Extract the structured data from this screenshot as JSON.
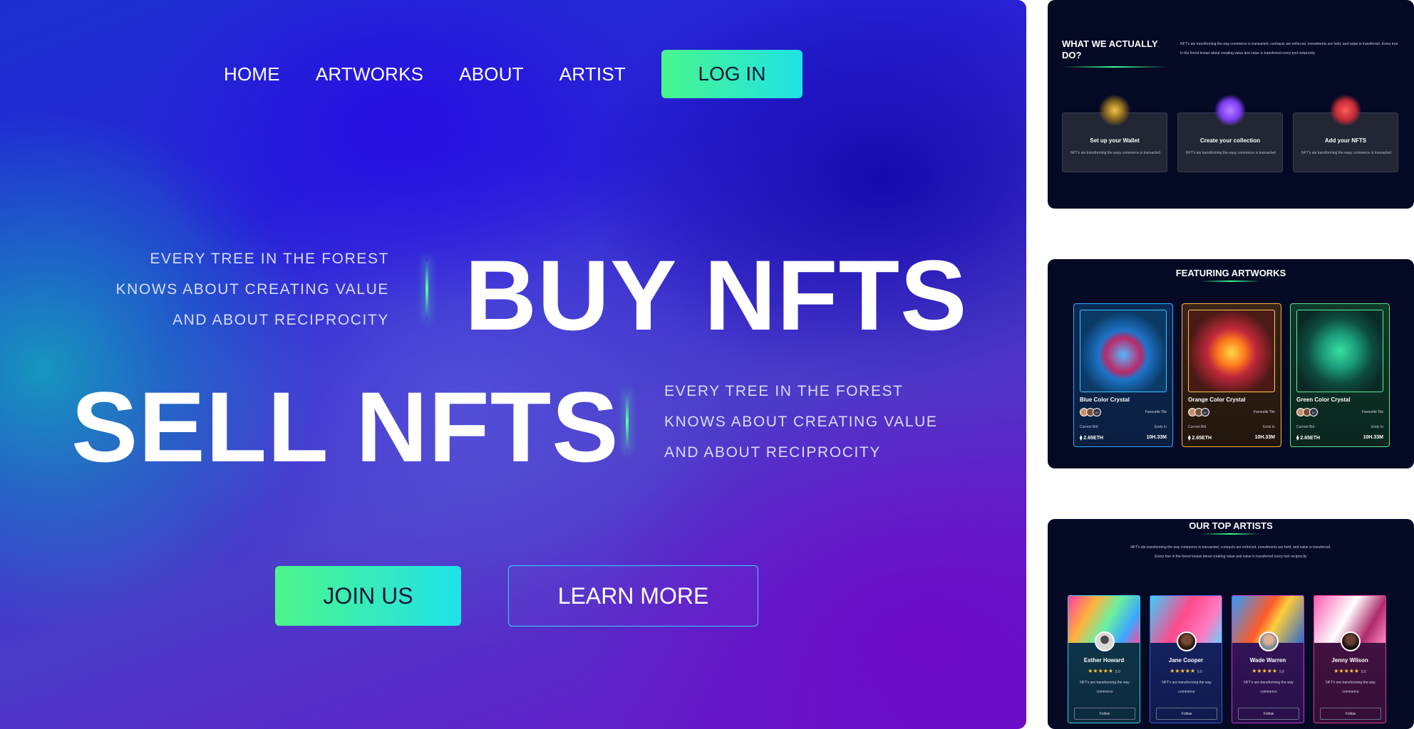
{
  "hero": {
    "nav": [
      "HOME",
      "ARTWORKS",
      "ABOUT",
      "ARTIST"
    ],
    "login_label": "LOG IN",
    "tagline_lines": [
      "EVERY TREE IN THE FOREST",
      "KNOWS ABOUT CREATING VALUE",
      "AND ABOUT RECIPROCITY"
    ],
    "buy_heading": "BUY NFTS",
    "sell_heading": "SELL NFTS",
    "join_label": "JOIN US",
    "learn_label": "LEARN MORE",
    "colors": {
      "gradient_button_start": "#4ef58a",
      "gradient_button_end": "#1fe2e8",
      "outline_button": "#3ad0ff"
    }
  },
  "what_we_do": {
    "title": "WHAT WE ACTUALLY DO?",
    "description": "NFT's ale transforming the way commerce is transacted, contracts are enforced, investments are held, and value is transferred. Every tree in the forest knows about creating value and value is transferred every tool reciprocity",
    "steps": [
      {
        "icon": "wallet-icon",
        "title": "Set up your Wallet",
        "desc": "NFT's ale transforming the wayy commerce is transacted"
      },
      {
        "icon": "camera-icon",
        "title": "Create your collection",
        "desc": "NFT's ale transforming the wayy commerce is transacted"
      },
      {
        "icon": "gift-icon",
        "title": "Add your NFTS",
        "desc": "NFT's ale transforming the wayy commerce is transacted"
      }
    ]
  },
  "featuring": {
    "title": "FEATURING ARTWORKS",
    "cards": [
      {
        "name": "Blue Color Crystal",
        "fav": "Favourite Tile",
        "badge": "2+",
        "bid_label": "Current Bid",
        "bid": "2.65ETH",
        "ends_label": "Ends In",
        "ends": "10H.33M"
      },
      {
        "name": "Orange Color Crystal",
        "fav": "Favourite Tile",
        "badge": "2+",
        "bid_label": "Current Bid",
        "bid": "2.65ETH",
        "ends_label": "Ends In",
        "ends": "10H.33M"
      },
      {
        "name": "Green Color Crystal",
        "fav": "Favourite Tile",
        "badge": "2+",
        "bid_label": "Current Bid",
        "bid": "2.65ETH",
        "ends_label": "Ends In",
        "ends": "10H.33M"
      }
    ],
    "eth_symbol": "⧫"
  },
  "top_artists": {
    "title": "OUR TOP ARTISTS",
    "description": "NFT's ale transforming the way commerce is transacted, contracts are enforced, investments are held, and value is transferred. Every tree in the forest knows about creating value and value is transferred every tool reciprocity",
    "artists": [
      {
        "name": "Esther Howard",
        "stars": "★★★★★",
        "rating": "5.0",
        "desc": "NFT's are transforming the way commerce",
        "follow": "Follow"
      },
      {
        "name": "Jane Cooper",
        "stars": "★★★★★",
        "rating": "5.0",
        "desc": "NFT's are transforming the way commerce",
        "follow": "Follow"
      },
      {
        "name": "Wade Warren",
        "stars": "★★★★★",
        "rating": "5.0",
        "desc": "NFT's are transforming the way commerce",
        "follow": "Follow"
      },
      {
        "name": "Jenny Wilson",
        "stars": "★★★★★",
        "rating": "5.0",
        "desc": "NFT's are transforming the way commerce",
        "follow": "Follow"
      }
    ]
  }
}
